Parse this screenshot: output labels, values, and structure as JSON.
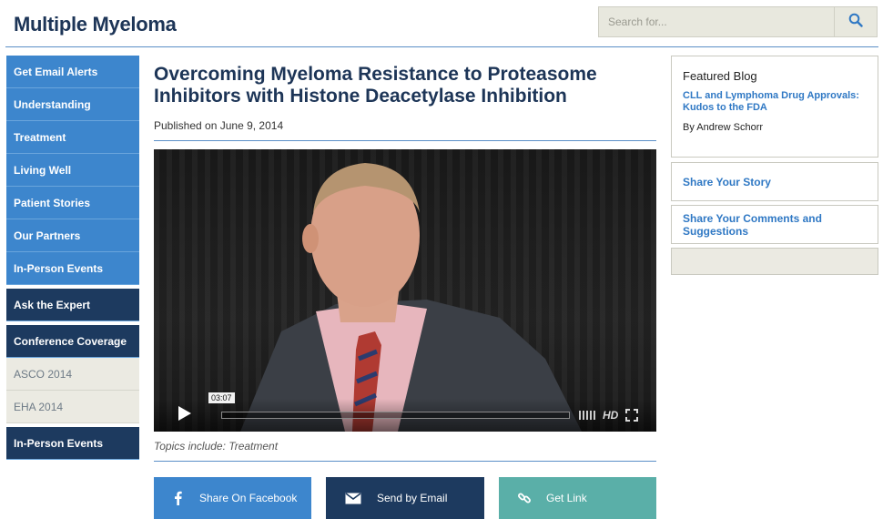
{
  "header": {
    "site_title": "Multiple Myeloma",
    "search_placeholder": "Search for..."
  },
  "nav": {
    "items": [
      {
        "label": "Get Email Alerts",
        "style": "blue"
      },
      {
        "label": "Understanding",
        "style": "blue"
      },
      {
        "label": "Treatment",
        "style": "blue"
      },
      {
        "label": "Living Well",
        "style": "blue"
      },
      {
        "label": "Patient Stories",
        "style": "blue"
      },
      {
        "label": "Our Partners",
        "style": "blue"
      },
      {
        "label": "In-Person Events",
        "style": "blue"
      },
      {
        "label": "Ask the Expert",
        "style": "dark"
      },
      {
        "label": "Conference Coverage",
        "style": "dark"
      },
      {
        "label": "ASCO 2014",
        "style": "light"
      },
      {
        "label": "EHA 2014",
        "style": "light"
      },
      {
        "label": "In-Person Events",
        "style": "dark"
      }
    ]
  },
  "article": {
    "title": "Overcoming Myeloma Resistance to Proteasome Inhibitors with Histone Deacetylase Inhibition",
    "published": "Published on June 9, 2014",
    "topics": "Topics include: Treatment"
  },
  "video": {
    "time": "03:07",
    "hd_label": "HD",
    "play_icon": "play-icon",
    "fullscreen_icon": "fullscreen-icon"
  },
  "share": {
    "facebook_label": "Share On Facebook",
    "email_label": "Send by Email",
    "link_label": "Get Link"
  },
  "sidebar": {
    "featured_heading": "Featured Blog",
    "featured_link": "CLL and Lymphoma Drug Approvals: Kudos to the FDA",
    "featured_author": "By Andrew Schorr",
    "share_story": "Share Your Story",
    "share_comments": "Share Your Comments and Suggestions"
  },
  "colors": {
    "brand_dark": "#1d3557",
    "nav_blue": "#3d86cd",
    "nav_dark": "#1d3a5f",
    "link_blue": "#2f78c4",
    "teal": "#5aafa8"
  }
}
